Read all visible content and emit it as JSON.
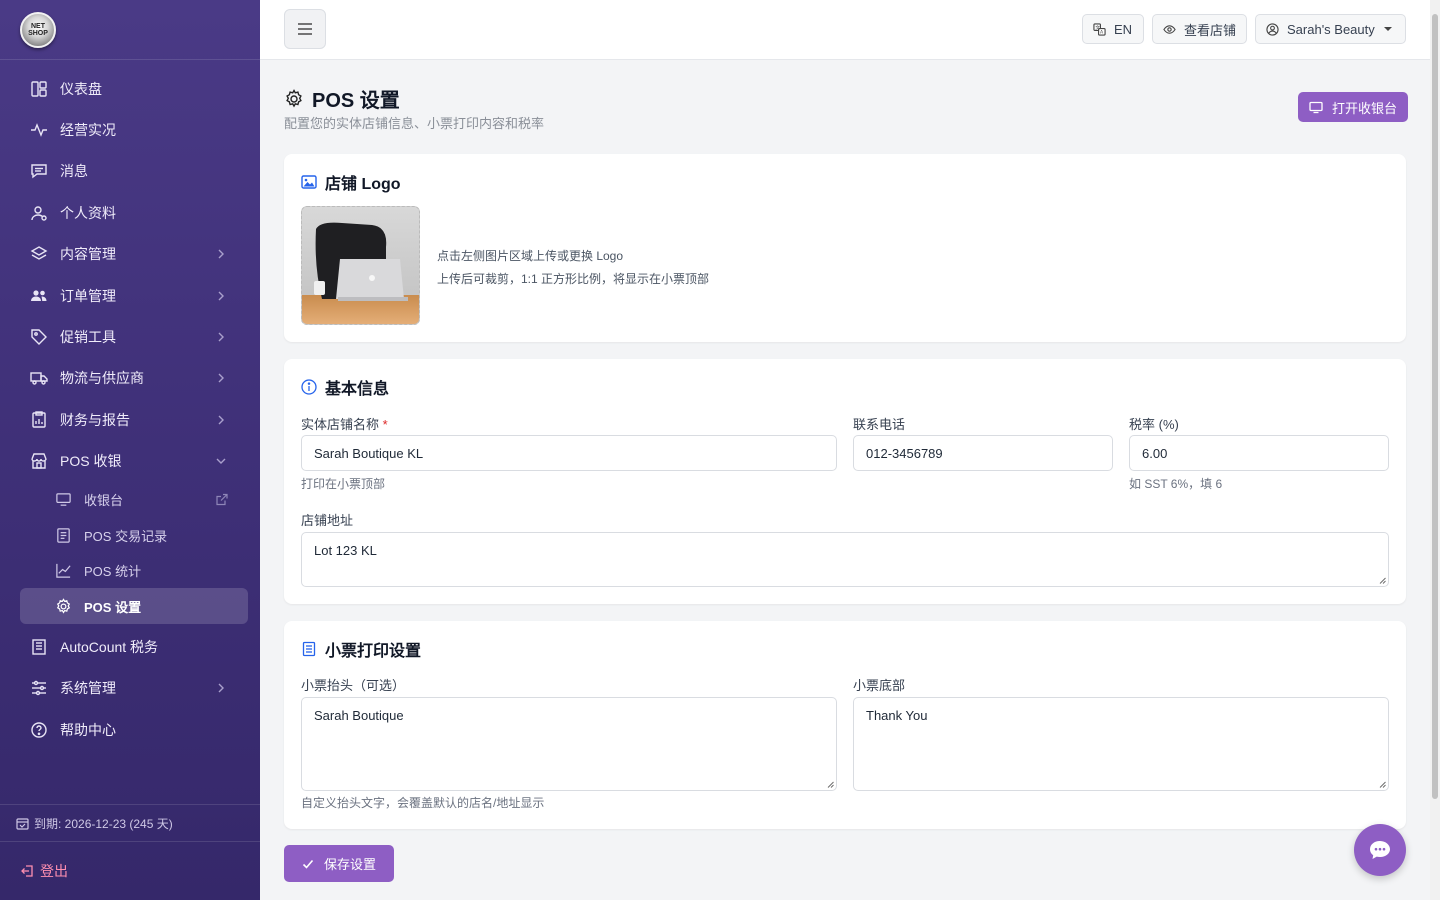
{
  "sidebar": {
    "logo_text": "NET SHOP",
    "items": [
      {
        "label": "仪表盘",
        "icon": "dashboard-icon",
        "chevron": false
      },
      {
        "label": "经营实况",
        "icon": "activity-icon",
        "chevron": false
      },
      {
        "label": "消息",
        "icon": "message-icon",
        "chevron": false
      },
      {
        "label": "个人资料",
        "icon": "user-icon",
        "chevron": false
      },
      {
        "label": "内容管理",
        "icon": "layers-icon",
        "chevron": true
      },
      {
        "label": "订单管理",
        "icon": "users-icon",
        "chevron": true
      },
      {
        "label": "促销工具",
        "icon": "tag-icon",
        "chevron": true
      },
      {
        "label": "物流与供应商",
        "icon": "truck-icon",
        "chevron": true
      },
      {
        "label": "财务与报告",
        "icon": "report-icon",
        "chevron": true
      },
      {
        "label": "POS 收银",
        "icon": "store-icon",
        "chevron": true
      }
    ],
    "pos_sub": [
      {
        "label": "收银台",
        "icon": "monitor-icon"
      },
      {
        "label": "POS 交易记录",
        "icon": "receipt-icon"
      },
      {
        "label": "POS 统计",
        "icon": "chart-line-icon"
      },
      {
        "label": "POS 设置",
        "icon": "gear-icon"
      }
    ],
    "after": [
      {
        "label": "AutoCount 税务",
        "icon": "building-icon",
        "chevron": false
      },
      {
        "label": "系统管理",
        "icon": "sliders-icon",
        "chevron": true
      },
      {
        "label": "帮助中心",
        "icon": "help-icon",
        "chevron": false
      }
    ],
    "expire": "到期: 2026-12-23 (245 天)",
    "logout": "登出"
  },
  "topbar": {
    "lang": "EN",
    "view_store": "查看店铺",
    "account": "Sarah's Beauty"
  },
  "page": {
    "title": "POS 设置",
    "subtitle": "配置您的实体店铺信息、小票打印内容和税率",
    "open_pos": "打开收银台"
  },
  "logo_card": {
    "title": "店铺 Logo",
    "hint1": "点击左侧图片区域上传或更换 Logo",
    "hint2": "上传后可裁剪，1:1 正方形比例，将显示在小票顶部"
  },
  "basic": {
    "title": "基本信息",
    "store_name_label": "实体店铺名称",
    "required_mark": "*",
    "store_name": "Sarah Boutique KL",
    "store_name_help": "打印在小票顶部",
    "phone_label": "联系电话",
    "phone": "012-3456789",
    "tax_label": "税率 (%)",
    "tax": "6.00",
    "tax_help": "如 SST 6%，填 6",
    "address_label": "店铺地址",
    "address": "Lot 123 KL"
  },
  "receipt": {
    "title": "小票打印设置",
    "header_label": "小票抬头（可选）",
    "header": "Sarah Boutique",
    "header_help": "自定义抬头文字，会覆盖默认的店名/地址显示",
    "footer_label": "小票底部",
    "footer": "Thank You"
  },
  "actions": {
    "save": "保存设置"
  },
  "colors": {
    "sidebar": "#3f3078",
    "accent": "#8e5ec4",
    "info_blue": "#2563eb"
  }
}
